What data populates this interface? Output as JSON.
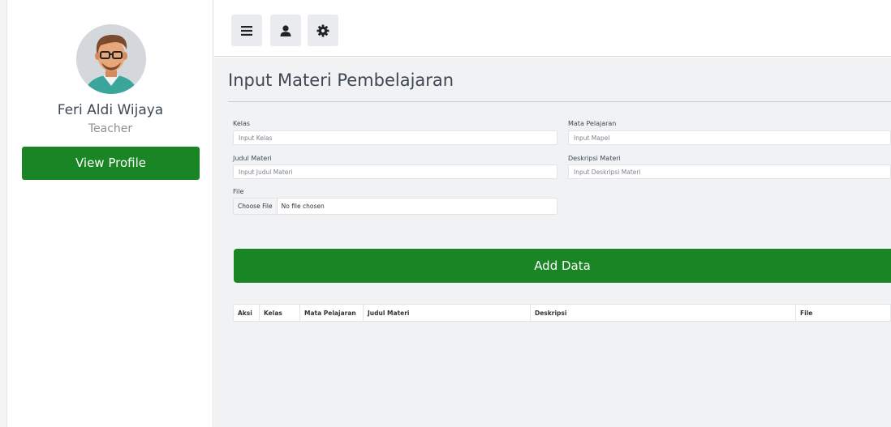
{
  "profile": {
    "name": "Feri Aldi Wijaya",
    "role": "Teacher",
    "view_profile_label": "View Profile"
  },
  "toolbar": {
    "buttons": [
      "menu-icon",
      "user-icon",
      "gear-icon"
    ]
  },
  "page": {
    "title": "Input Materi Pembelajaran"
  },
  "form": {
    "kelas": {
      "label": "Kelas",
      "placeholder": "Input Kelas",
      "value": ""
    },
    "mapel": {
      "label": "Mata Pelajaran",
      "placeholder": "Input Mapel",
      "value": ""
    },
    "judul": {
      "label": "Judul Materi",
      "placeholder": "Input Judul Materi",
      "value": ""
    },
    "deskripsi": {
      "label": "Deskripsi Materi",
      "placeholder": "Input Deskripsi Materi",
      "value": ""
    },
    "file": {
      "label": "File",
      "button_label": "Choose File",
      "status": "No file chosen"
    }
  },
  "actions": {
    "add_data_label": "Add Data"
  },
  "table": {
    "columns": [
      "Aksi",
      "Kelas",
      "Mata Pelajaran",
      "Judul Materi",
      "Deskripsi",
      "File"
    ],
    "rows": []
  },
  "colors": {
    "primary_green": "#1a8525",
    "main_background": "#f1f2f4",
    "toolbar_button_bg": "#e9ebee",
    "title_text": "#3e4853"
  }
}
